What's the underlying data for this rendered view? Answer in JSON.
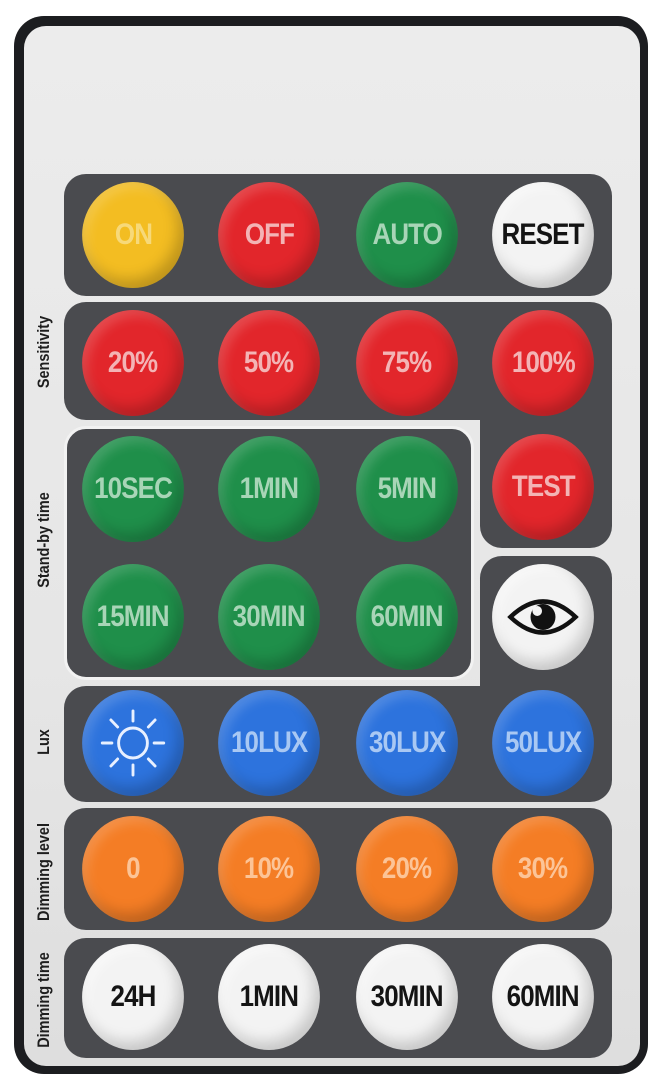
{
  "row_power": {
    "on": "ON",
    "off": "OFF",
    "auto": "AUTO",
    "reset": "RESET"
  },
  "sensitivity": {
    "label": "Sensitivity",
    "b1": "20%",
    "b2": "50%",
    "b3": "75%",
    "b4": "100%"
  },
  "standby": {
    "label": "Stand-by time",
    "b1": "10SEC",
    "b2": "1MIN",
    "b3": "5MIN",
    "b4": "15MIN",
    "b5": "30MIN",
    "b6": "60MIN"
  },
  "test": "TEST",
  "lux": {
    "label": "Lux",
    "b2": "10LUX",
    "b3": "30LUX",
    "b4": "50LUX"
  },
  "dimming_level": {
    "label": "Dimming level",
    "b1": "0",
    "b2": "10%",
    "b3": "20%",
    "b4": "30%"
  },
  "dimming_time": {
    "label": "Dimming time",
    "b1": "24H",
    "b2": "1MIN",
    "b3": "30MIN",
    "b4": "60MIN"
  },
  "icons": {
    "sun": "sun-icon",
    "eye": "eye-icon"
  },
  "colors": {
    "yellow": "#f3bd22",
    "red": "#e2262b",
    "green": "#1f8f4a",
    "blue": "#2d73dd",
    "orange": "#f47d25",
    "white": "#f3f3f3",
    "panel": "#4a4b4f",
    "body": "#1c1d20"
  }
}
